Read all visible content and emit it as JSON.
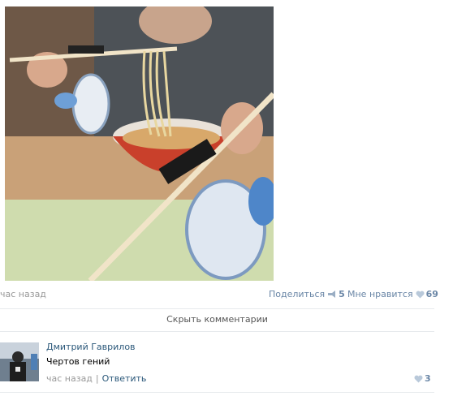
{
  "post": {
    "photo_icon": "noodle-fan-photo",
    "time": "час назад",
    "share": {
      "label": "Поделиться",
      "count": "5",
      "icon": "megaphone-icon"
    },
    "like": {
      "label": "Мне нравится",
      "count": "69",
      "icon": "heart-icon"
    }
  },
  "comments": {
    "hide_label": "Скрыть комментарии",
    "items": [
      {
        "author": "Дмитрий Гаврилов",
        "text": "Чертов гений",
        "time": "час назад",
        "reply_label": "Ответить",
        "likes": "3"
      }
    ]
  },
  "colors": {
    "link": "#2b587a",
    "muted": "#999999",
    "accent": "#6a86a6"
  }
}
